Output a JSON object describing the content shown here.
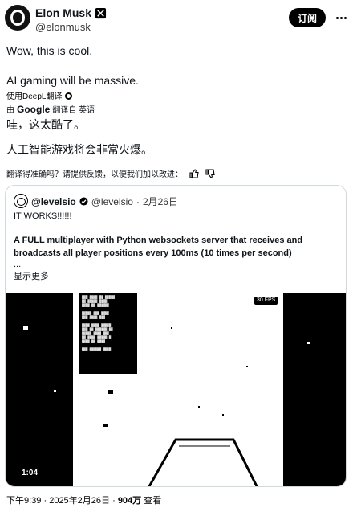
{
  "author": {
    "display_name": "Elon Musk",
    "handle": "@elonmusk",
    "verified_icon": "verified-badge-icon"
  },
  "header": {
    "subscribe_label": "订阅",
    "more_icon": "more-icon"
  },
  "post": {
    "line1": "Wow, this is cool.",
    "line2": "AI gaming will be massive.",
    "deepl_label": "使用DeepL翻译",
    "translated_by_prefix": "由",
    "translated_by_brand": "Google",
    "translated_by_suffix": "翻译自 英语",
    "translated_line1": "哇，这太酷了。",
    "translated_line2": "人工智能游戏将会非常火爆。",
    "feedback_prompt": "翻译得准确吗？请提供反馈，以便我们加以改进："
  },
  "quote": {
    "display_name": "@levelsio",
    "handle": "@levelsio",
    "separator": "·",
    "date": "2月26日",
    "line1": "IT WORKS!!!!!!",
    "line2": "A FULL multiplayer with Python websockets server that receives and",
    "line3": "broadcasts all player positions every 100ms (10 times per second)",
    "ellipsis": "...",
    "show_more": "显示更多",
    "video": {
      "duration": "1:04",
      "fps_label": "30 FPS"
    }
  },
  "footer": {
    "time": "下午9:39",
    "date": "2025年2月26日",
    "views": "904万",
    "views_suffix": "查看"
  }
}
